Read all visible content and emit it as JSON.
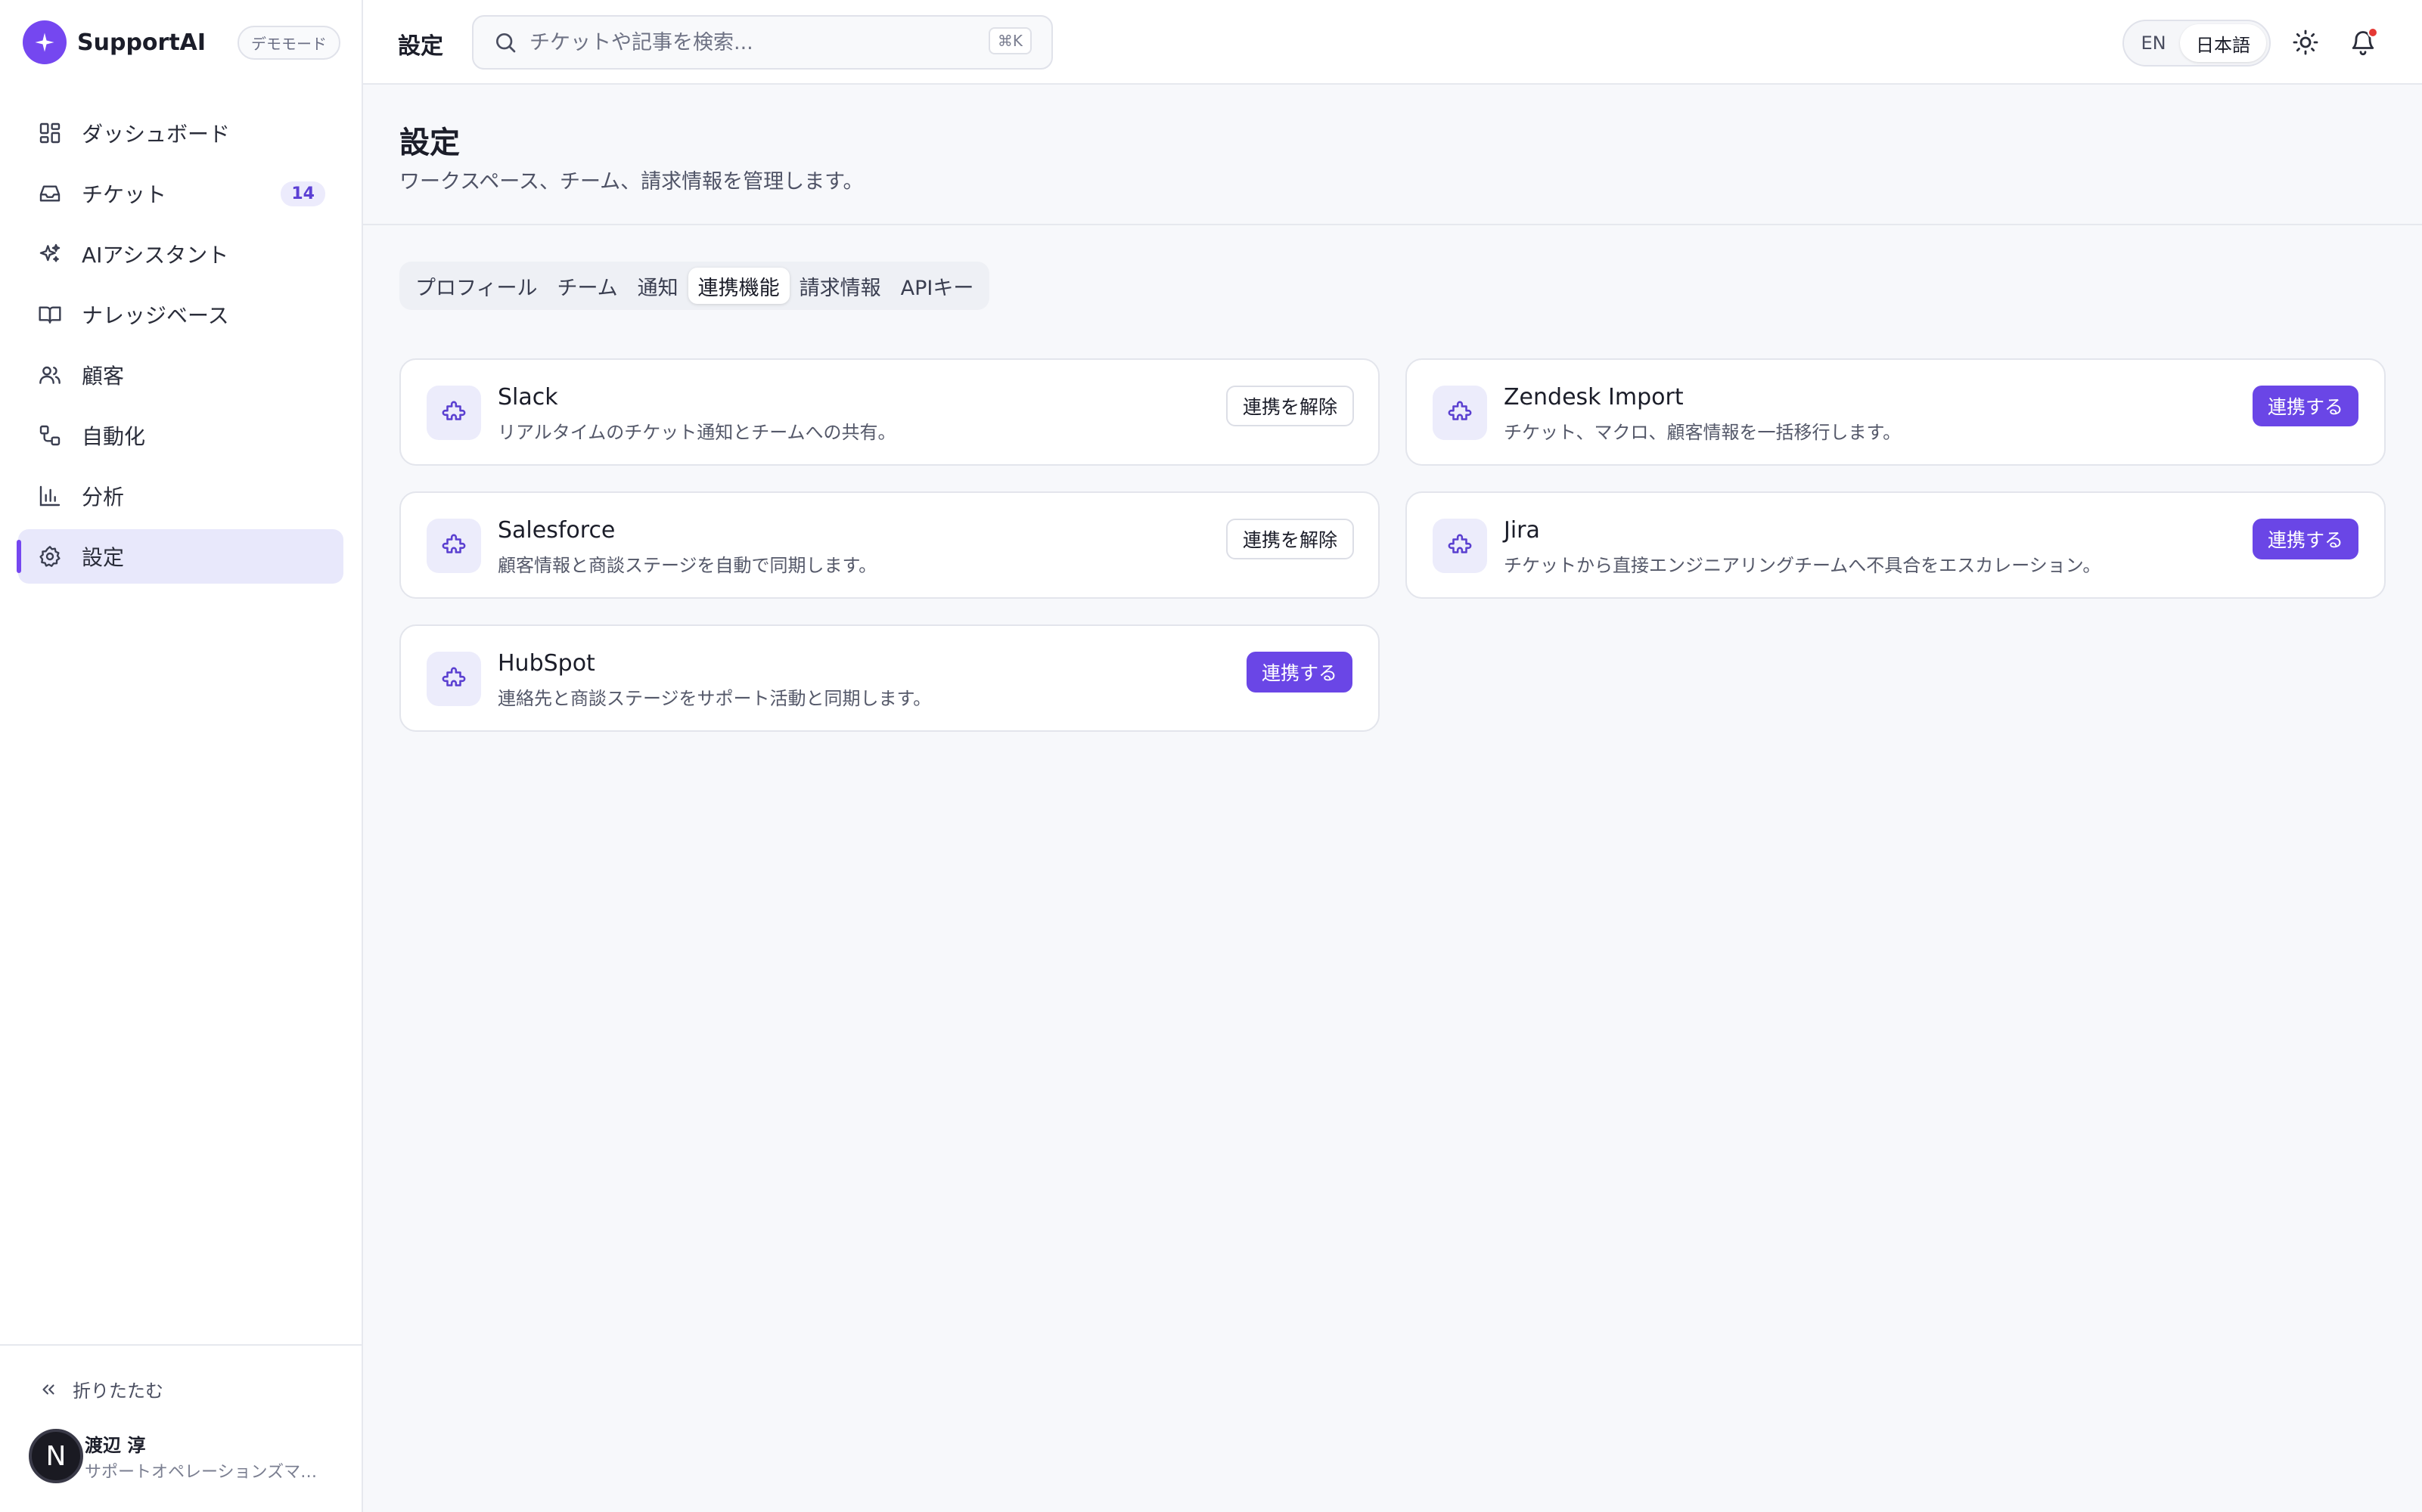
{
  "brand": {
    "name": "SupportAI",
    "mode_badge": "デモモード"
  },
  "sidebar": {
    "items": [
      {
        "label": "ダッシュボード",
        "icon": "dashboard-icon"
      },
      {
        "label": "チケット",
        "icon": "inbox-icon",
        "badge": "14"
      },
      {
        "label": "AIアシスタント",
        "icon": "sparkles-icon"
      },
      {
        "label": "ナレッジベース",
        "icon": "book-icon"
      },
      {
        "label": "顧客",
        "icon": "users-icon"
      },
      {
        "label": "自動化",
        "icon": "workflow-icon"
      },
      {
        "label": "分析",
        "icon": "bar-chart-icon"
      },
      {
        "label": "設定",
        "icon": "gear-icon",
        "active": true
      }
    ],
    "collapse_label": "折りたたむ",
    "user": {
      "initial": "N",
      "name": "渡辺 淳",
      "role": "サポートオペレーションズマネージャー"
    }
  },
  "header": {
    "title": "設定",
    "search": {
      "placeholder": "チケットや記事を検索...",
      "shortcut": "⌘K"
    },
    "lang": {
      "en": "EN",
      "ja": "日本語",
      "selected": "ja"
    }
  },
  "page": {
    "title": "設定",
    "subtitle": "ワークスペース、チーム、請求情報を管理します。"
  },
  "tabs": [
    {
      "label": "プロフィール"
    },
    {
      "label": "チーム"
    },
    {
      "label": "通知"
    },
    {
      "label": "連携機能",
      "active": true
    },
    {
      "label": "請求情報"
    },
    {
      "label": "APIキー"
    }
  ],
  "integrations": [
    {
      "name": "Slack",
      "description": "リアルタイムのチケット通知とチームへの共有。",
      "action": "連携を解除",
      "connected": true
    },
    {
      "name": "Zendesk Import",
      "description": "チケット、マクロ、顧客情報を一括移行します。",
      "action": "連携する",
      "connected": false
    },
    {
      "name": "Salesforce",
      "description": "顧客情報と商談ステージを自動で同期します。",
      "action": "連携を解除",
      "connected": true
    },
    {
      "name": "Jira",
      "description": "チケットから直接エンジニアリングチームへ不具合をエスカレーション。",
      "action": "連携する",
      "connected": false
    },
    {
      "name": "HubSpot",
      "description": "連絡先と商談ステージをサポート活動と同期します。",
      "action": "連携する",
      "connected": false
    }
  ],
  "colors": {
    "accent": "#6a46e6",
    "brand": "#7547f0",
    "active_nav_bg": "#e8e8fb",
    "notification": "#e53935"
  }
}
